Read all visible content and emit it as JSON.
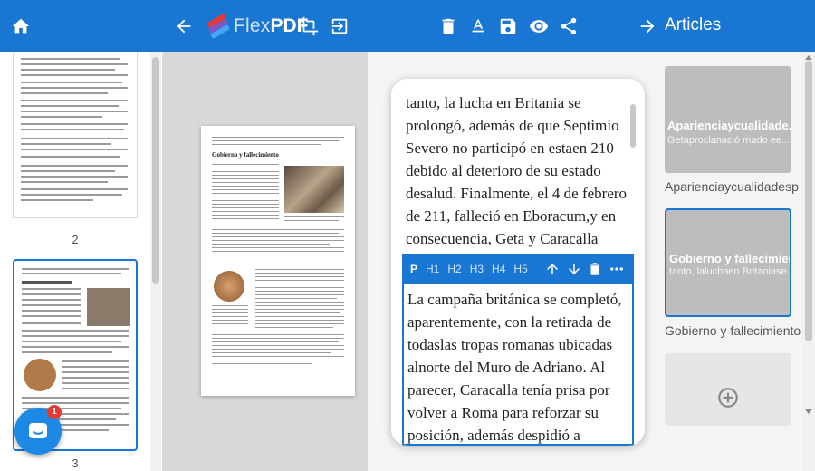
{
  "header": {
    "brand_flex": "Flex",
    "brand_pdf": "PDF",
    "articles_title": "Articles",
    "colors": {
      "bar": "#1976d2",
      "accent": "#1976d2"
    }
  },
  "thumbnails": {
    "pages": [
      {
        "number": "2"
      },
      {
        "number": "3"
      }
    ]
  },
  "page": {
    "heading": "Gobierno y fallecimiento"
  },
  "preview": {
    "paragraph1": "tanto, la lucha en Britania se prolongó, además de que Septimio Severo no participó en estaen 210 debido al deterioro de su estado desalud. Finalmente, el 4 de febrero de 211, falleció en Eboracum,y en consecuencia, Geta y Caracalla subieron al trono.",
    "paragraph2": "La campaña británica se completó, aparentemente, con la retirada de todaslas tropas romanas ubicadas alnorte del Muro de Adriano. Al parecer, Caracalla tenía prisa por volver a Roma para reforzar su posición, además despidió a muchos de los consejeros de su padre y ejecutó",
    "toolbar": {
      "p": "P",
      "h1": "H1",
      "h2": "H2",
      "h3": "H3",
      "h4": "H4",
      "h5": "H5"
    }
  },
  "articles": {
    "items": [
      {
        "card_title": "Aparienciaycualidade...",
        "card_sub": "Getaproclanació mado ee...",
        "label": "Aparienciaycualidadesp"
      },
      {
        "card_title": "Gobierno y fallecimien...",
        "card_sub": "tanto, laluchaen Britaniase...",
        "label": "Gobierno y fallecimiento"
      }
    ]
  },
  "chat": {
    "badge_count": "1"
  }
}
